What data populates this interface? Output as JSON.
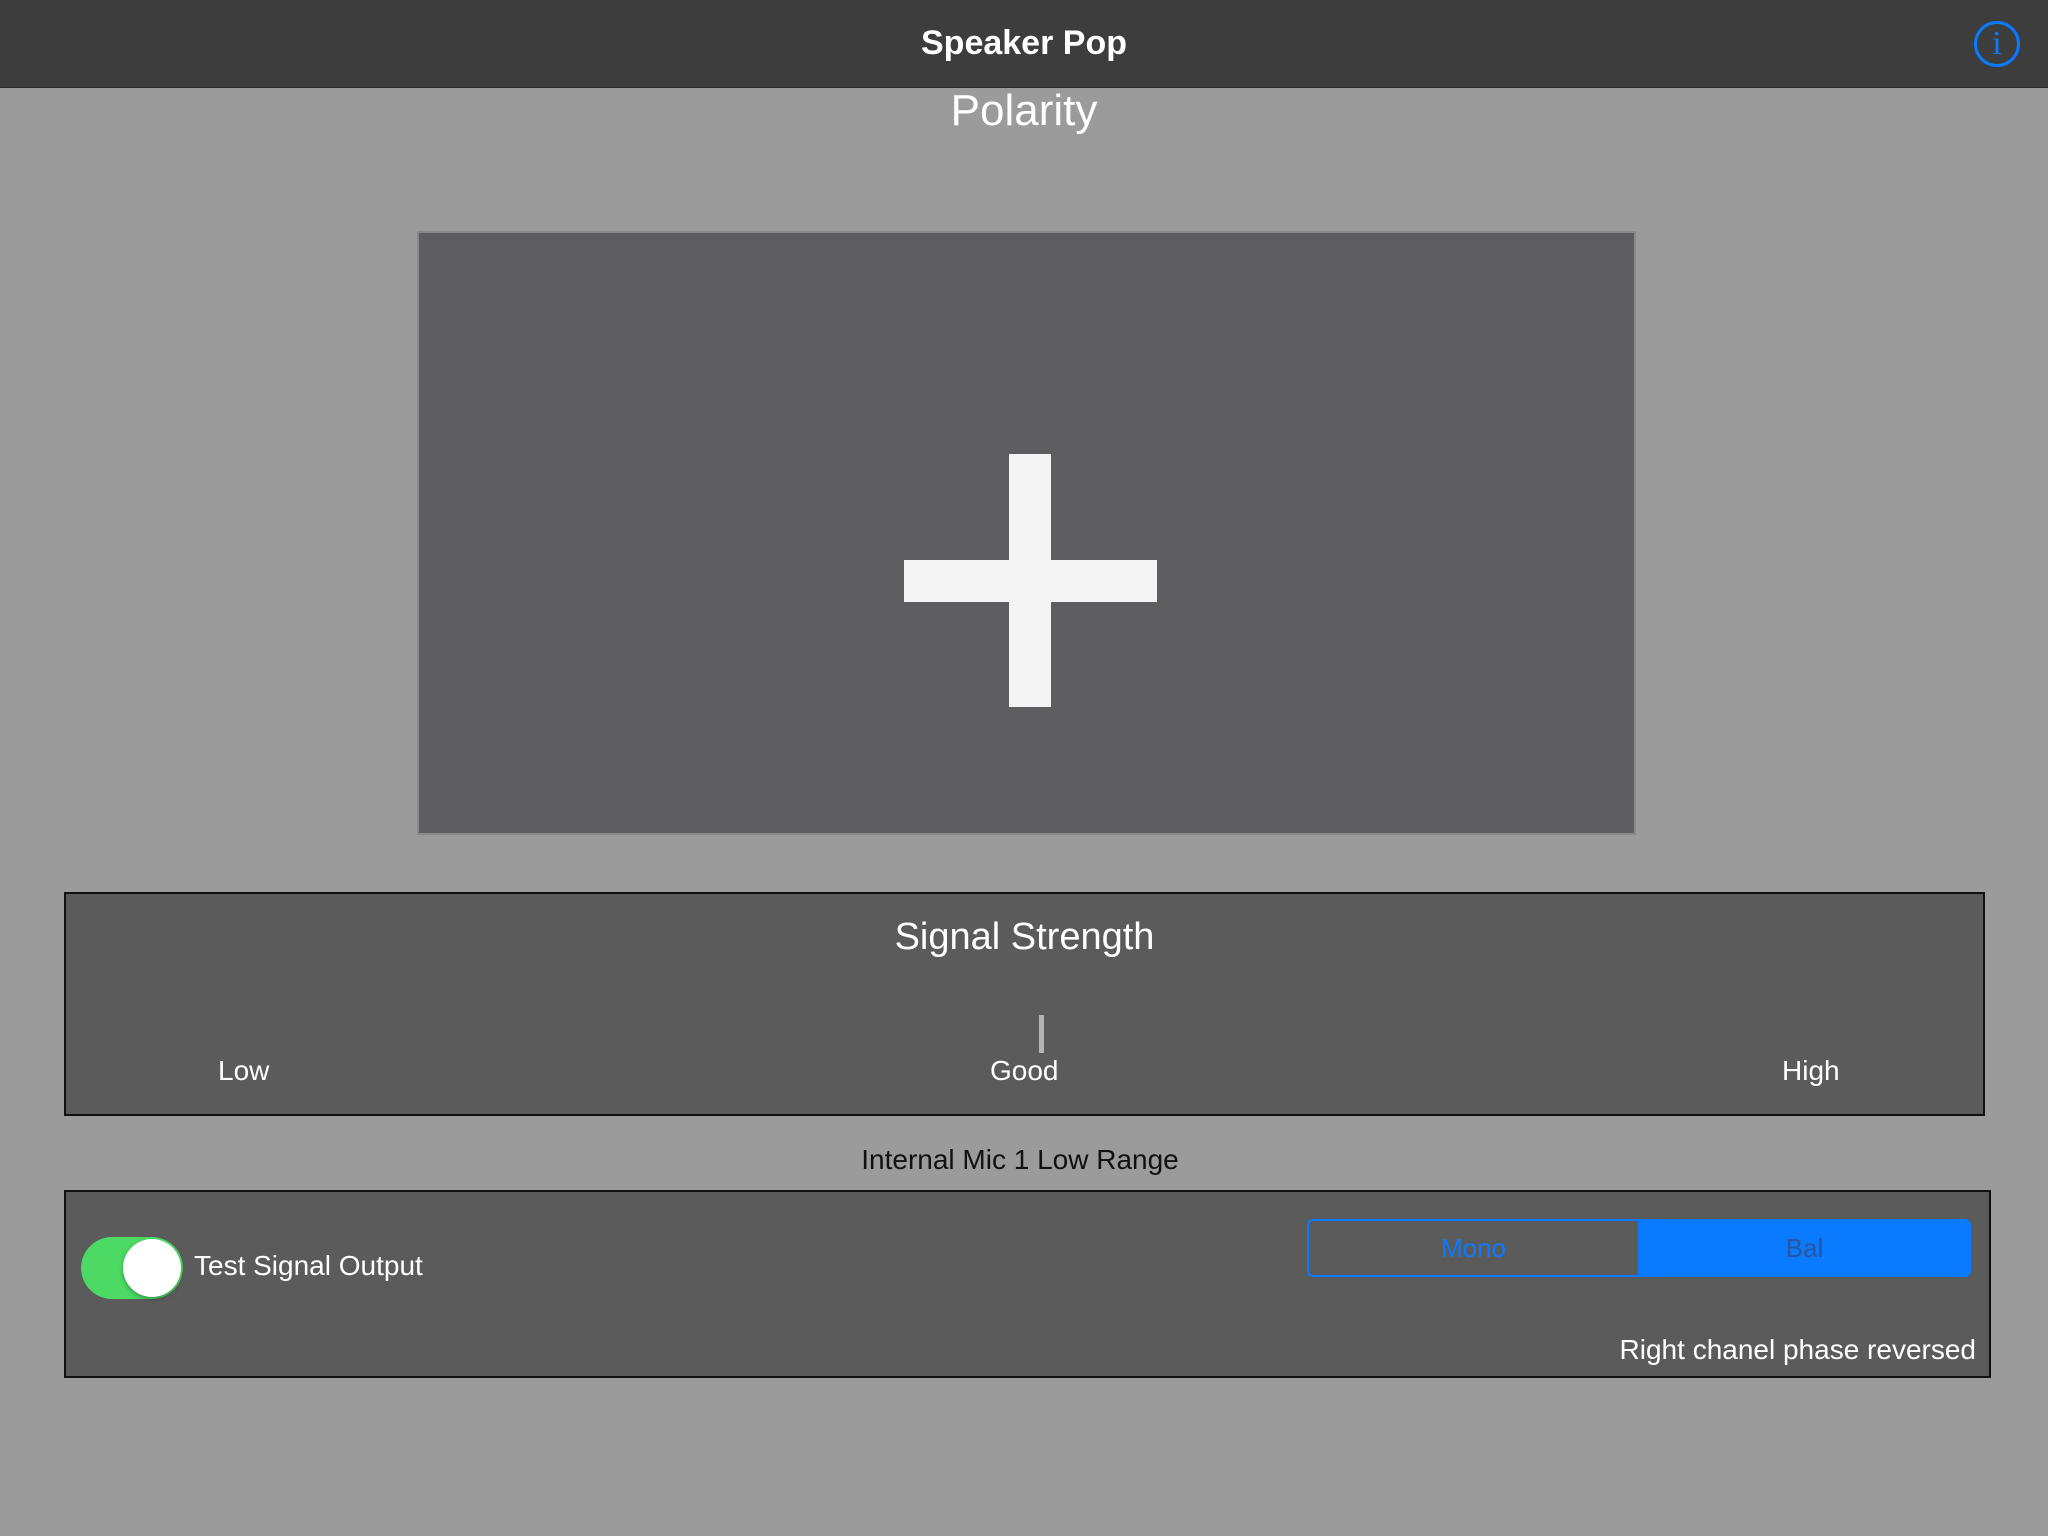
{
  "navbar": {
    "title": "Speaker Pop",
    "info_icon": "info-circle-icon",
    "info_glyph": "i",
    "accent_color": "#0a7afe"
  },
  "section": {
    "title": "Polarity"
  },
  "polarity_display": {
    "symbol_icon": "plus-icon"
  },
  "signal_strength": {
    "title": "Signal Strength",
    "labels": {
      "low": "Low",
      "good": "Good",
      "high": "High"
    }
  },
  "input_source": "Internal Mic 1 Low Range",
  "controls": {
    "toggle_label": "Test Signal Output",
    "toggle_on": true,
    "toggle_color": "#4cd964",
    "segments": [
      {
        "label": "Mono",
        "selected": false
      },
      {
        "label": "Bal",
        "selected": true
      }
    ],
    "status": "Right chanel phase reversed"
  }
}
